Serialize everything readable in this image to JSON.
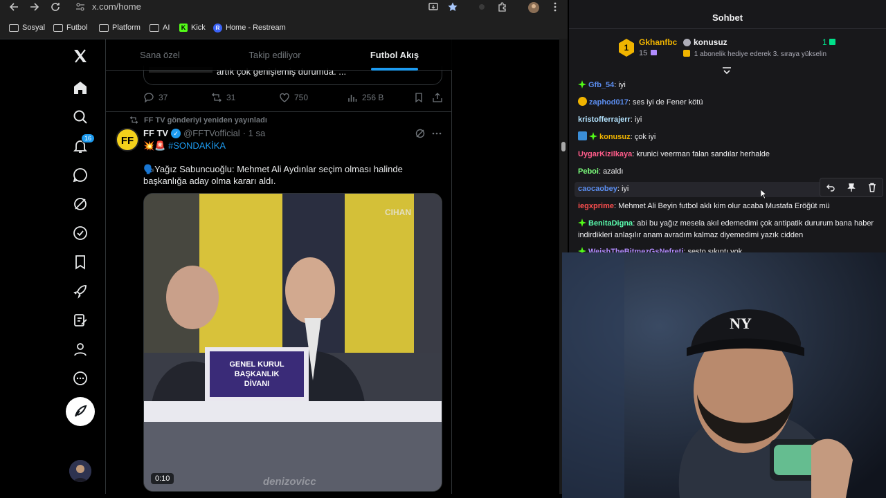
{
  "browser": {
    "url": "x.com/home",
    "bookmarks": [
      {
        "label": "Sosyal",
        "icon": "folder-icon"
      },
      {
        "label": "Futbol",
        "icon": "folder-icon"
      },
      {
        "label": "Platform",
        "icon": "folder-icon"
      },
      {
        "label": "AI",
        "icon": "folder-icon"
      },
      {
        "label": "Kick",
        "icon": "kick-icon"
      },
      {
        "label": "Home - Restream",
        "icon": "restream-icon"
      }
    ]
  },
  "twitter": {
    "notification_count": "16",
    "tabs": [
      {
        "label": "Sana özel",
        "active": false
      },
      {
        "label": "Takip ediliyor",
        "active": false
      },
      {
        "label": "Futbol Akış",
        "active": true
      }
    ],
    "previous_post": {
      "card_text": "artık çok genişlemiş durumda. ...",
      "replies": "37",
      "reposts": "31",
      "likes": "750",
      "views": "256 B"
    },
    "post": {
      "repost_note": "FF TV gönderiyi yeniden yayınladı",
      "author_name": "FF TV",
      "handle": "@FFTVofficial",
      "time": "· 1 sa",
      "avatar_text": "FF",
      "hashtag_line": "💥🚨 #SONDAKİKA",
      "text": "🗣️Yağız Sabuncuoğlu: Mehmet Ali Aydınlar seçim olması halinde başkanlığa aday olma kararı aldı.",
      "video_time": "0:10",
      "video_watermark": "denizovicc",
      "video_channel": "CIHAN",
      "sign_line1": "GENEL KURUL",
      "sign_line2": "BAŞKANLIK",
      "sign_line3": "DİVANI"
    }
  },
  "chat": {
    "title": "Sohbet",
    "gift": {
      "rank": "1",
      "gifter": "Gkhanfbc",
      "gifter_count": "15",
      "recipient": "konusuz",
      "message": "1 abonelik hediye ederek 3. sıraya yükselin",
      "count": "1"
    },
    "messages": [
      {
        "user": "Gfb_54",
        "color": "#5b8def",
        "text": ": iyi",
        "badge": "green"
      },
      {
        "user": "zaphod017",
        "color": "#5b8def",
        "text": ": ses iyi de Fener kötü",
        "badge": "gold"
      },
      {
        "user": "kristofferrajerr",
        "color": "#b4e4ff",
        "text": ": iyi",
        "badge": ""
      },
      {
        "user": "konusuz",
        "color": "#f0b400",
        "text": ": çok iyi",
        "badge": "double"
      },
      {
        "user": "UygarKizilkaya",
        "color": "#ff5c8a",
        "text": ": krunici veerman falan sandılar herhalde",
        "badge": ""
      },
      {
        "user": "Peboi",
        "color": "#7cff7c",
        "text": ": azaldı",
        "badge": ""
      },
      {
        "user": "caocaobey",
        "color": "#5b8def",
        "text": ": iyi",
        "badge": ""
      },
      {
        "user": "iegxprime",
        "color": "#ff4f4f",
        "text": ": Mehmet Ali Beyin futbol aklı kim olur acaba Mustafa Eröğüt mü",
        "badge": ""
      },
      {
        "user": "BenitaDigna",
        "color": "#5bffb0",
        "text": ": abi bu yağız mesela akıl edemedimi çok antipatik dururum bana haber indirdikleri anlaşılır anam avradım kalmaz diyemedimi yazık cidden",
        "badge": "green"
      },
      {
        "user": "WeishTheBitmezGsNefreti",
        "color": "#b18cff",
        "text": ": sesto sıkıntı yok",
        "badge": "green"
      }
    ]
  },
  "webcam": {
    "cap_logo": "NY"
  },
  "colors": {
    "twitter_blue": "#1d9bf0",
    "kick_green": "#53fc18",
    "chat_bg": "#18181b"
  }
}
